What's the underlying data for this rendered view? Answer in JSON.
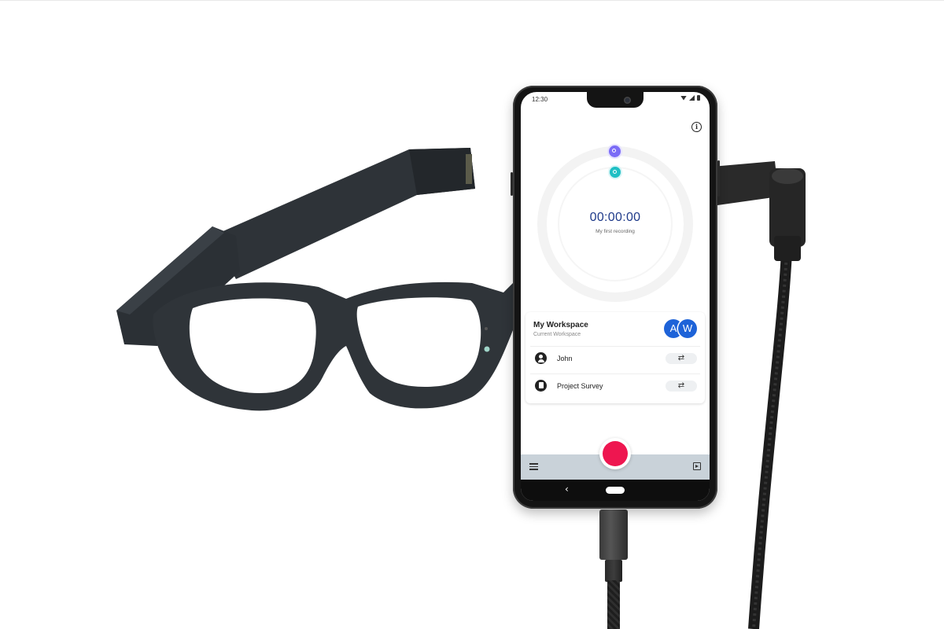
{
  "status_bar": {
    "time": "12:30"
  },
  "recorder": {
    "timer": "00:00:00",
    "recording_name": "My first recording",
    "info_icon": "i",
    "scene_camera_icon": "camera-icon",
    "eye_camera_icon": "eye-icon"
  },
  "workspace": {
    "title": "My Workspace",
    "subtitle": "Current Workspace",
    "avatars": [
      "A",
      "W"
    ],
    "rows": [
      {
        "label": "John",
        "icon": "person-icon",
        "action": "⇄"
      },
      {
        "label": "Project Survey",
        "icon": "document-icon",
        "action": "⇄"
      }
    ]
  },
  "bottom_bar": {
    "menu_icon": "menu-icon",
    "media_icon": "play-library-icon"
  },
  "nav": {
    "back": "‹"
  },
  "colors": {
    "record": "#ee1650",
    "timer": "#1e3a8a",
    "avatar": "#1e63d8",
    "scene_cam": "#7b6cf6",
    "eye_cam": "#1fbfc4",
    "bottom_bar": "#c9d2d9"
  }
}
